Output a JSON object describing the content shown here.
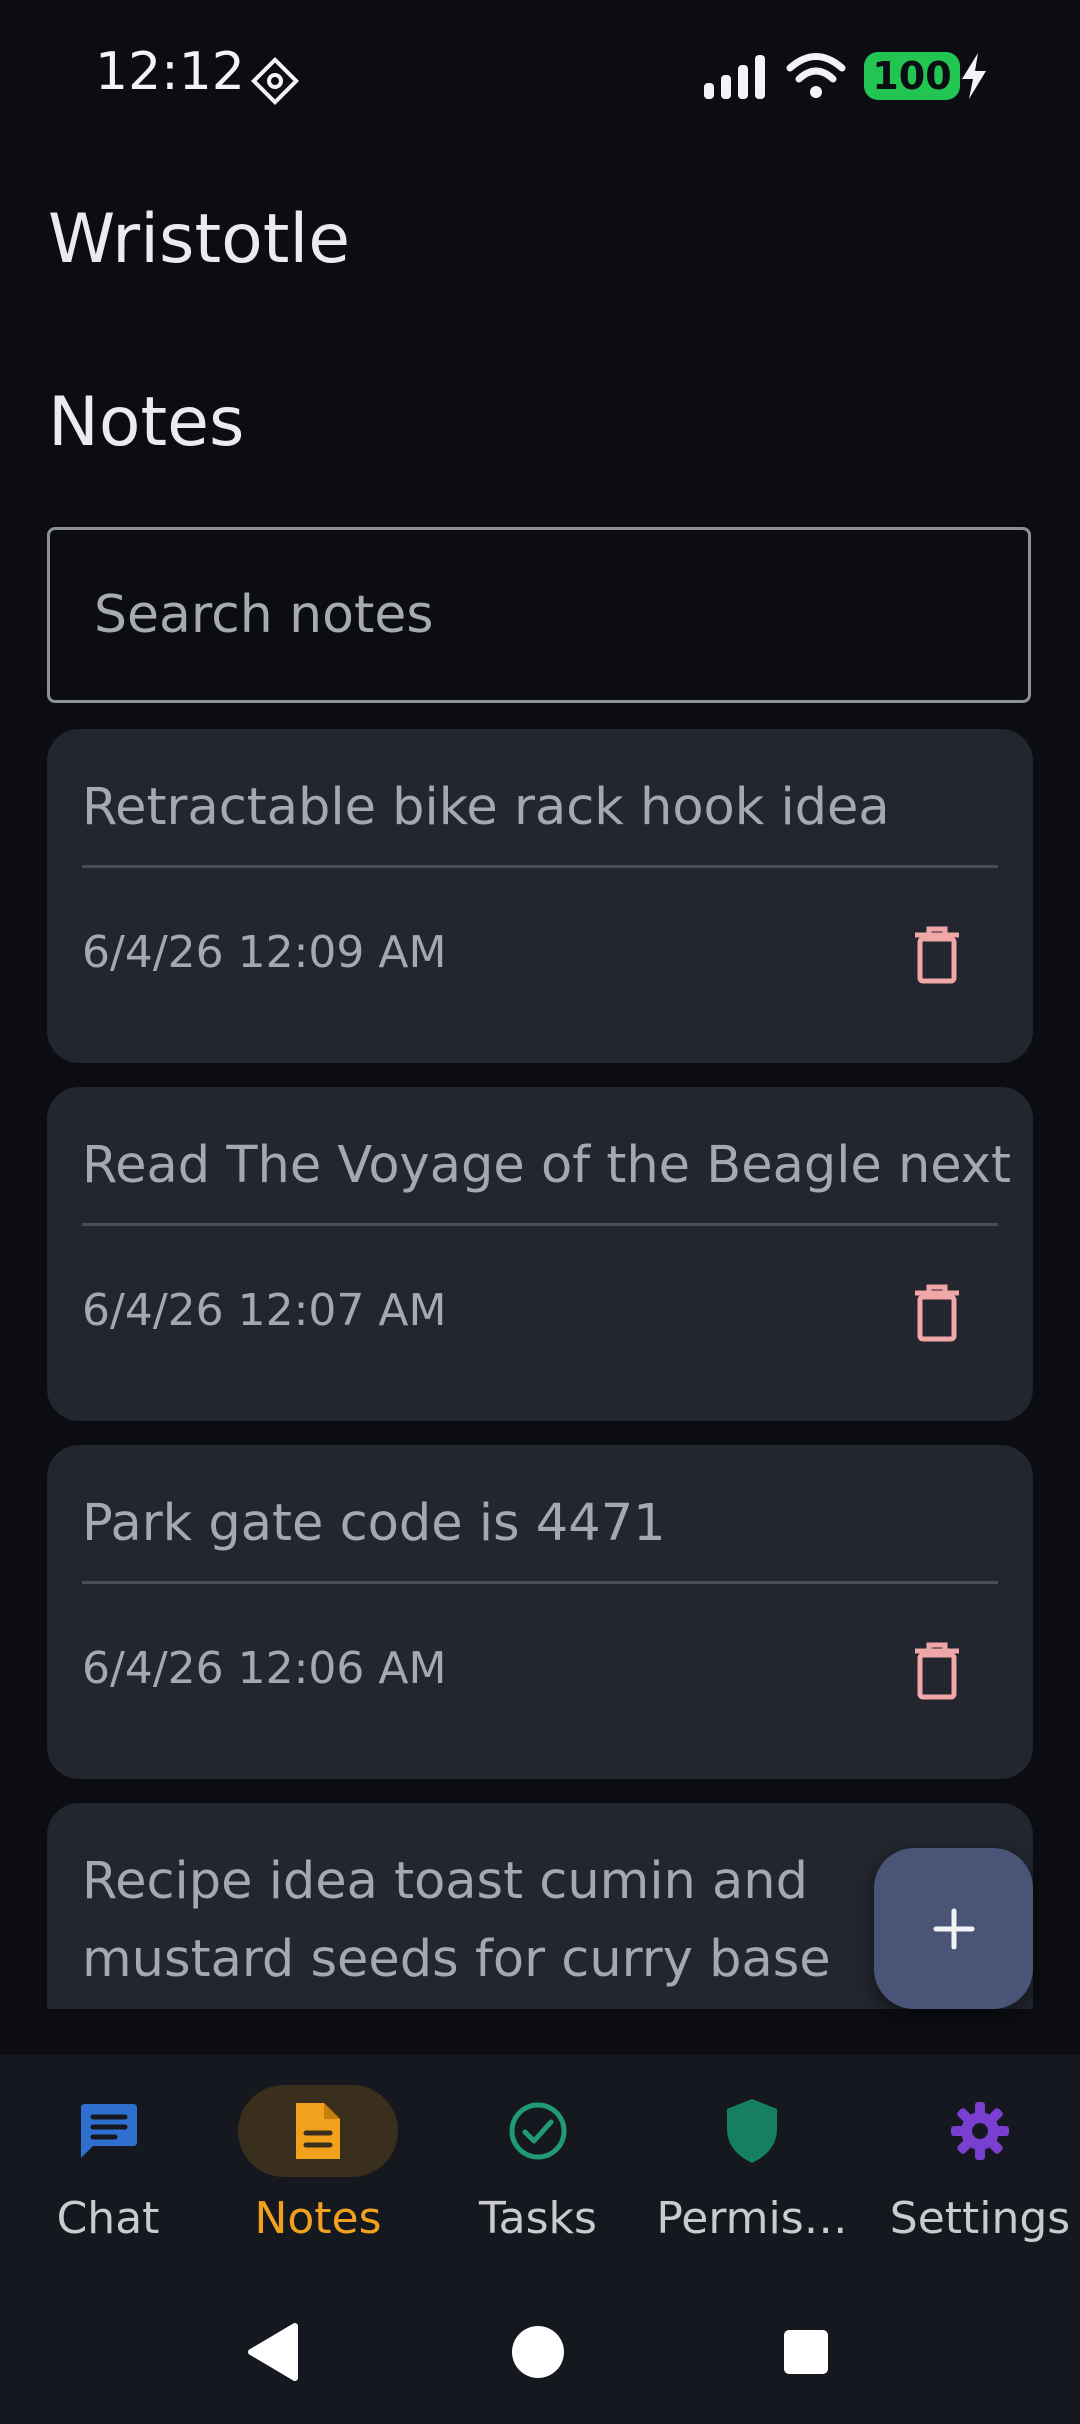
{
  "status_bar": {
    "time": "12:12",
    "battery": "100",
    "icons": [
      "notification-icon",
      "signal-icon",
      "wifi-icon",
      "battery-icon",
      "charging-icon"
    ]
  },
  "app": {
    "title": "Wristotle"
  },
  "notes_screen": {
    "title": "Notes",
    "search_placeholder": "Search notes",
    "add_button_label": "+",
    "notes": [
      {
        "text": "Retractable bike rack hook idea",
        "date": "6/4/26 12:09 AM"
      },
      {
        "text": "Read The Voyage of the Beagle next",
        "date": "6/4/26 12:07 AM"
      },
      {
        "text": "Park gate code is 4471",
        "date": "6/4/26 12:06 AM"
      },
      {
        "text": "Recipe idea toast cumin and mustard seeds for curry base",
        "date": ""
      }
    ]
  },
  "bottom_nav": {
    "items": [
      {
        "label": "Chat",
        "icon": "chat-icon",
        "color": "#2f6fd0"
      },
      {
        "label": "Notes",
        "icon": "notes-icon",
        "color": "#f1a11b",
        "active": true
      },
      {
        "label": "Tasks",
        "icon": "tasks-icon",
        "color": "#1f9a73"
      },
      {
        "label": "Permis…",
        "icon": "shield-icon",
        "color": "#1f9a73"
      },
      {
        "label": "Settings",
        "icon": "gear-icon",
        "color": "#7a3fd0"
      }
    ]
  },
  "colors": {
    "background": "#0b0d12",
    "card": "#23252f",
    "accent": "#f1a11b",
    "trash": "#f0a7a8",
    "fab": "#4a5476"
  }
}
